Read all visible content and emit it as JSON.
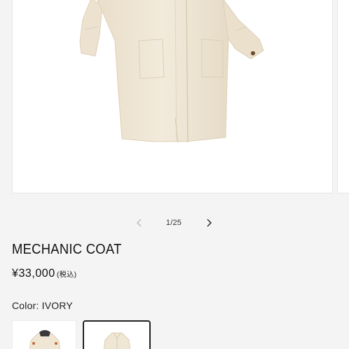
{
  "product": {
    "title": "MECHANIC COAT",
    "price": "¥33,000",
    "tax_note": "(税込)",
    "color_label": "Color: IVORY"
  },
  "gallery": {
    "counter": "1/25",
    "prev_icon": "chevron-left-icon",
    "next_icon": "chevron-right-icon",
    "coat_color": "#efe6d4"
  }
}
